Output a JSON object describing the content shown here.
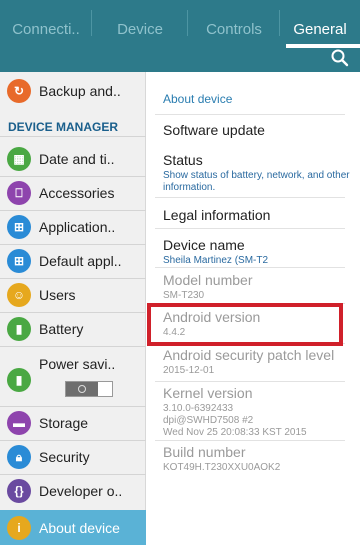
{
  "tabs": [
    {
      "label": "Connecti.."
    },
    {
      "label": "Device"
    },
    {
      "label": "Controls"
    },
    {
      "label": "General"
    }
  ],
  "sidebar": {
    "section_label": "DEVICE MANAGER",
    "items": [
      {
        "label": "Backup and..",
        "icon": "backup-icon",
        "color": "#e86a2a"
      },
      {
        "label": "Date and ti..",
        "icon": "calendar-icon",
        "color": "#4aa843"
      },
      {
        "label": "Accessories",
        "icon": "accessories-icon",
        "color": "#8e44ad"
      },
      {
        "label": "Application..",
        "icon": "apps-icon",
        "color": "#2a8bd6"
      },
      {
        "label": "Default appl..",
        "icon": "default-apps-icon",
        "color": "#2a8bd6"
      },
      {
        "label": "Users",
        "icon": "users-icon",
        "color": "#e6a81e"
      },
      {
        "label": "Battery",
        "icon": "battery-icon",
        "color": "#4aa843"
      },
      {
        "label": "Power savi..",
        "icon": "power-saving-icon",
        "color": "#4aa843"
      },
      {
        "label": "Storage",
        "icon": "storage-icon",
        "color": "#8e44ad"
      },
      {
        "label": "Security",
        "icon": "lock-icon",
        "color": "#2a8bd6"
      },
      {
        "label": "Developer o..",
        "icon": "developer-icon",
        "color": "#6a4aa0"
      },
      {
        "label": "About device",
        "icon": "info-icon",
        "color": "#e6a81e"
      }
    ]
  },
  "content": {
    "heading": "About device",
    "rows": [
      {
        "title": "Software update",
        "sub": ""
      },
      {
        "title": "Status",
        "sub": "Show status of battery, network, and other information."
      },
      {
        "title": "Legal information",
        "sub": ""
      },
      {
        "title": "Device name",
        "sub": "Sheila Martinez (SM-T2"
      },
      {
        "title": "Model number",
        "sub": "SM-T230"
      },
      {
        "title": "Android version",
        "sub": "4.4.2"
      },
      {
        "title": "Android security patch level",
        "sub": "2015-12-01"
      },
      {
        "title": "Kernel version",
        "sub1": "3.10.0-6392433",
        "sub2": "dpi@SWHD7508 #2",
        "sub3": "Wed Nov 25 20:08:33 KST 2015"
      },
      {
        "title": "Build number",
        "sub": "KOT49H.T230XXU0AOK2"
      }
    ]
  },
  "colors": {
    "header": "#2d7a8a",
    "active": "#5ab2d6",
    "highlight": "#d0202a"
  }
}
